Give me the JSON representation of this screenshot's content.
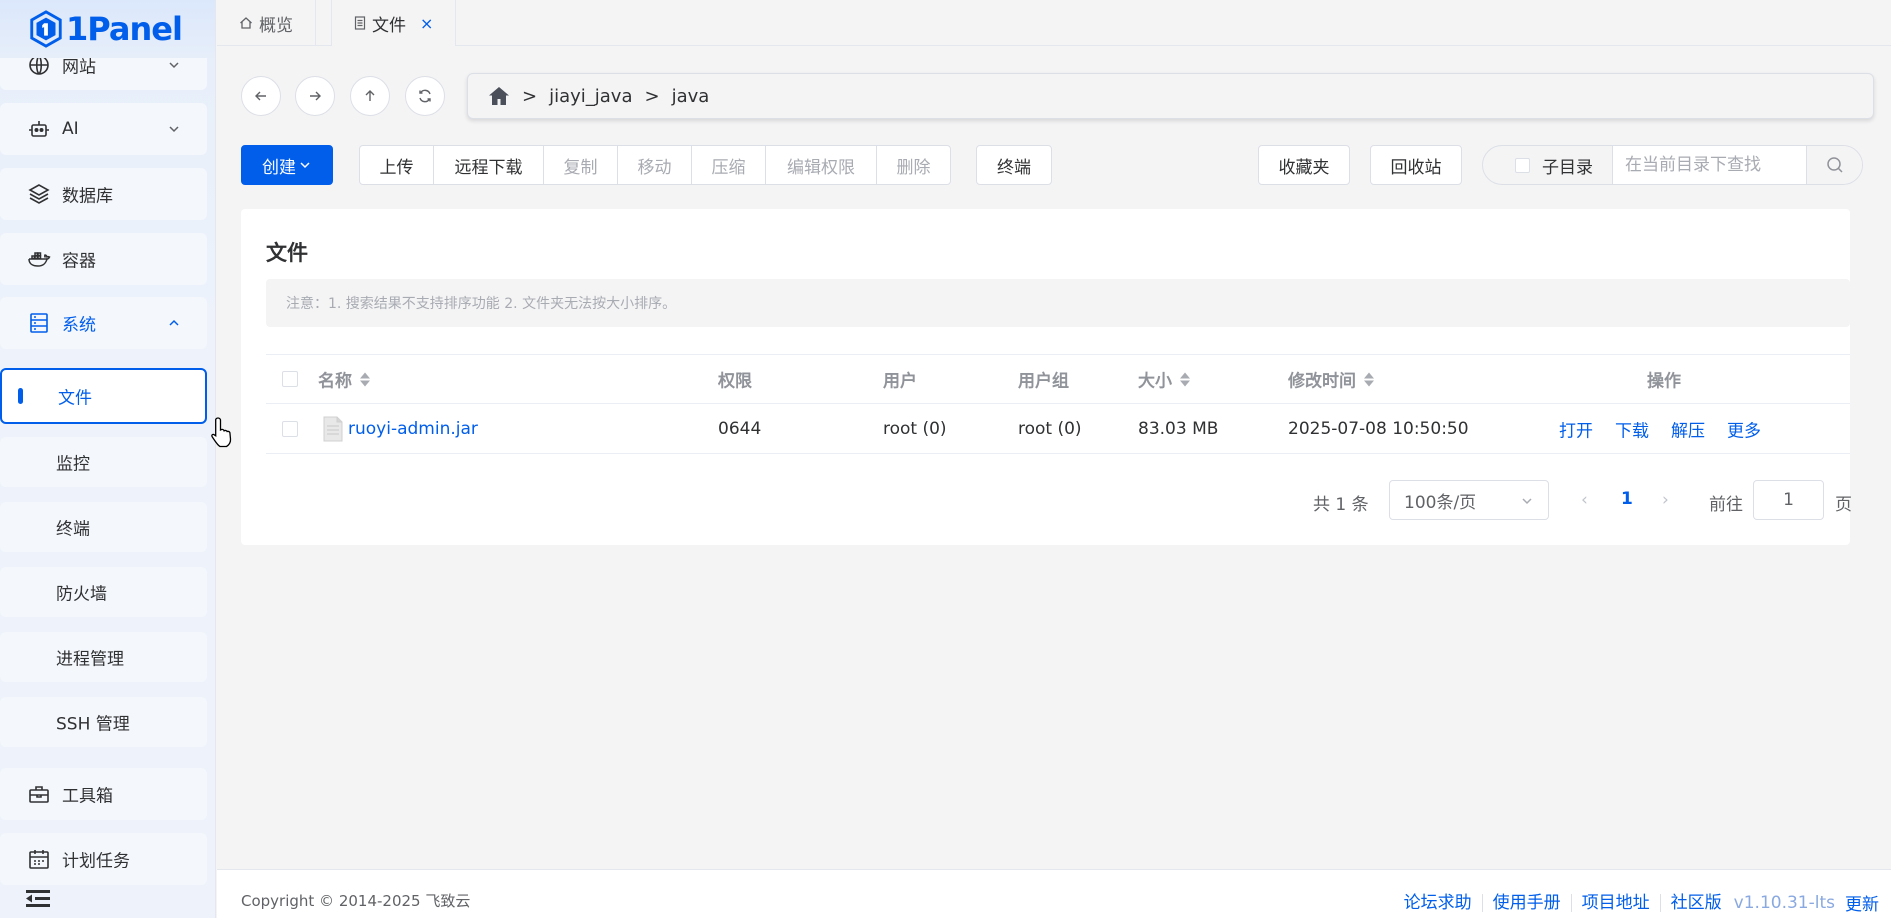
{
  "app": {
    "logo_text": "1Panel",
    "brand_color": "#005eeb"
  },
  "sidebar": {
    "items": [
      {
        "label": "网站",
        "icon": "globe-icon"
      },
      {
        "label": "AI",
        "icon": "robot-icon"
      },
      {
        "label": "数据库",
        "icon": "layers-icon"
      },
      {
        "label": "容器",
        "icon": "docker-icon"
      },
      {
        "label": "系统",
        "icon": "server-icon"
      },
      {
        "label": "文件"
      },
      {
        "label": "监控"
      },
      {
        "label": "终端"
      },
      {
        "label": "防火墙"
      },
      {
        "label": "进程管理"
      },
      {
        "label": "SSH 管理"
      },
      {
        "label": "工具箱",
        "icon": "toolbox-icon"
      },
      {
        "label": "计划任务",
        "icon": "calendar-icon"
      }
    ],
    "selected": "文件"
  },
  "tabs": [
    {
      "label": "概览",
      "icon": "home-icon"
    },
    {
      "label": "文件",
      "icon": "file-icon",
      "closable": true,
      "close_glyph": "×"
    }
  ],
  "path": {
    "segments": [
      "jiayi_java",
      "java"
    ],
    "separator": ">"
  },
  "toolbar": {
    "create": "创建",
    "upload": "上传",
    "remote_download": "远程下载",
    "copy": "复制",
    "move": "移动",
    "compress": "压缩",
    "edit_perms": "编辑权限",
    "delete": "删除",
    "terminal": "终端",
    "favorites": "收藏夹",
    "recycle_bin": "回收站",
    "subdir": "子目录",
    "search_placeholder": "在当前目录下查找"
  },
  "content": {
    "title": "文件",
    "notice": "注意：1. 搜索结果不支持排序功能 2. 文件夹无法按大小排序。",
    "columns": {
      "name": "名称",
      "perm": "权限",
      "user": "用户",
      "group": "用户组",
      "size": "大小",
      "mtime": "修改时间",
      "ops": "操作"
    },
    "rows": [
      {
        "name": "ruoyi-admin.jar",
        "perm": "0644",
        "user": "root (0)",
        "group": "root (0)",
        "size": "83.03 MB",
        "mtime": "2025-07-08 10:50:50",
        "ops": [
          "打开",
          "下载",
          "解压",
          "更多"
        ]
      }
    ]
  },
  "pagination": {
    "total": "共 1 条",
    "page_size": "100条/页",
    "current": "1",
    "goto_label": "前往",
    "goto_value": "1",
    "page_label": "页",
    "prev_glyph": "‹",
    "next_glyph": "›"
  },
  "footer": {
    "copyright": "Copyright © 2014-2025 飞致云",
    "links": [
      "论坛求助",
      "使用手册",
      "项目地址",
      "社区版"
    ],
    "version": "v1.10.31-lts",
    "update": "更新"
  }
}
